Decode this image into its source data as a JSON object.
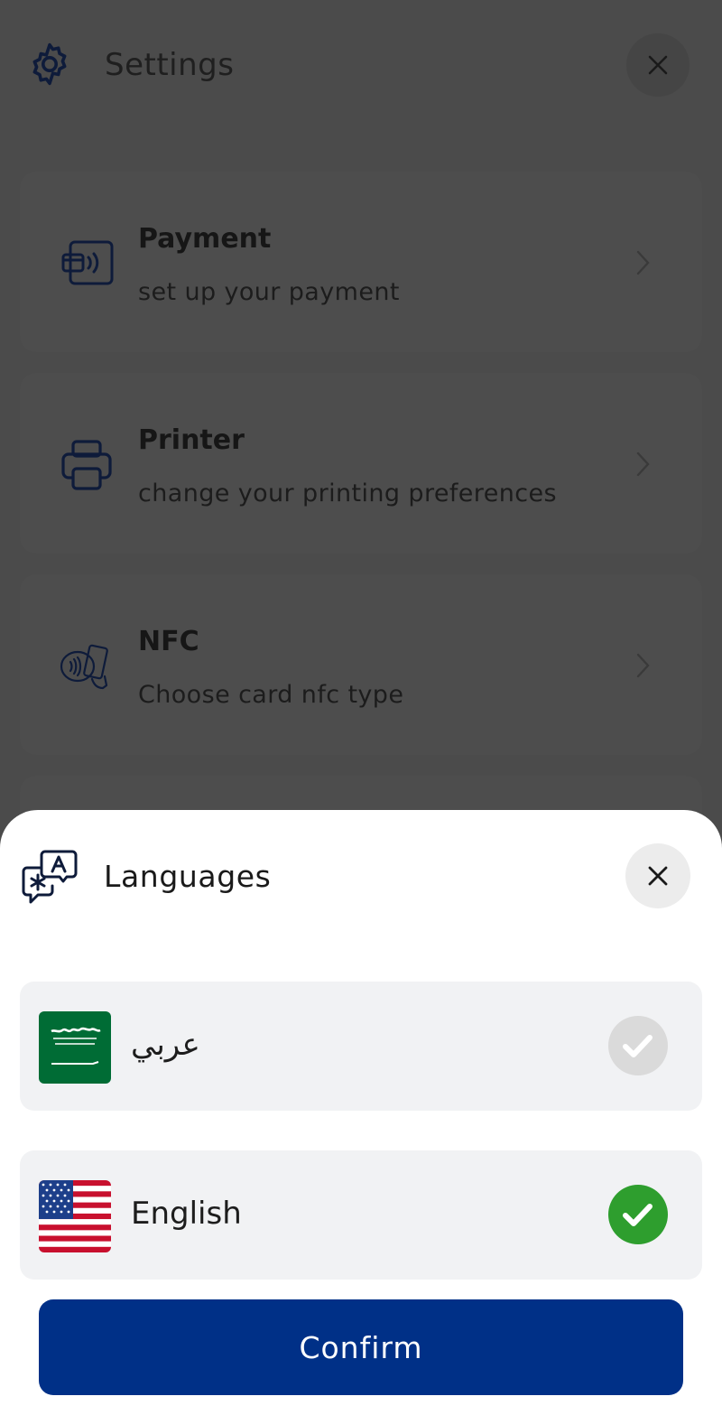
{
  "background": {
    "header": {
      "title": "Settings",
      "icon": "gear-icon",
      "close_icon": "close-icon"
    },
    "items": [
      {
        "title": "Payment",
        "subtitle": "set up your payment",
        "icon": "payment-card-icon"
      },
      {
        "title": "Printer",
        "subtitle": "change your printing preferences",
        "icon": "printer-icon"
      },
      {
        "title": "NFC",
        "subtitle": "Choose card nfc type",
        "icon": "nfc-card-icon"
      }
    ]
  },
  "sheet": {
    "title": "Languages",
    "icon": "languages-icon",
    "close_icon": "close-icon",
    "options": [
      {
        "label": "عربي",
        "flag": "saudi-arabia-flag",
        "selected": false
      },
      {
        "label": "English",
        "flag": "usa-flag",
        "selected": true
      }
    ],
    "confirm_label": "Confirm"
  },
  "colors": {
    "primary": "#003087",
    "selected_check": "#2e9e2e",
    "unselected_check": "#dadada",
    "overlay": "#4b4b4b"
  }
}
